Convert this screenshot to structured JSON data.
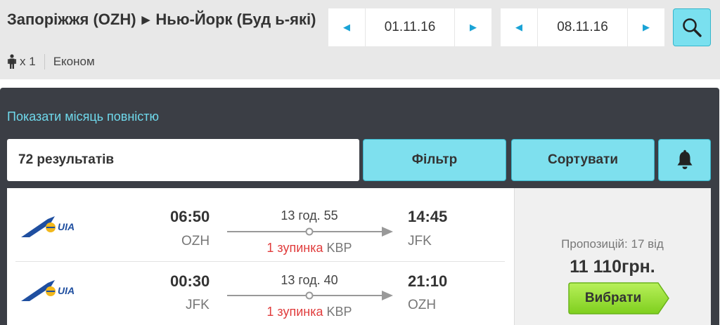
{
  "header": {
    "origin": "Запоріжжя (OZH)",
    "arrow_glyph": "▶",
    "destination": "Нью-Йорк (Буд ь-які)",
    "passengers": "x 1",
    "cabin_class": "Економ",
    "depart_date": "01.11.16",
    "return_date": "08.11.16",
    "prev_glyph": "◀",
    "next_glyph": "▶"
  },
  "results": {
    "month_link": "Показати місяць повністю",
    "count_text": "72 результатів",
    "filter_label": "Фільтр",
    "sort_label": "Сортувати"
  },
  "flight": {
    "airline": "UIA",
    "outbound": {
      "depart_time": "06:50",
      "depart_code": "OZH",
      "duration": "13 год. 55",
      "stops": "1 зупинка",
      "via": "KBP",
      "arrive_time": "14:45",
      "arrive_code": "JFK"
    },
    "inbound": {
      "depart_time": "00:30",
      "depart_code": "JFK",
      "duration": "13 год. 40",
      "stops": "1 зупинка",
      "via": "KBP",
      "arrive_time": "21:10",
      "arrive_code": "OZH"
    },
    "offers_text": "Пропозицій: 17 від",
    "price": "11 110грн.",
    "choose_label": "Вибрати"
  },
  "colors": {
    "accent": "#1aa3d6",
    "button_cyan": "#7ee0ee",
    "panel_dark": "#3b3e45",
    "link_cyan": "#6fd9ec",
    "stop_red": "#e03c3c",
    "choose_green": "#8fdc2a"
  }
}
